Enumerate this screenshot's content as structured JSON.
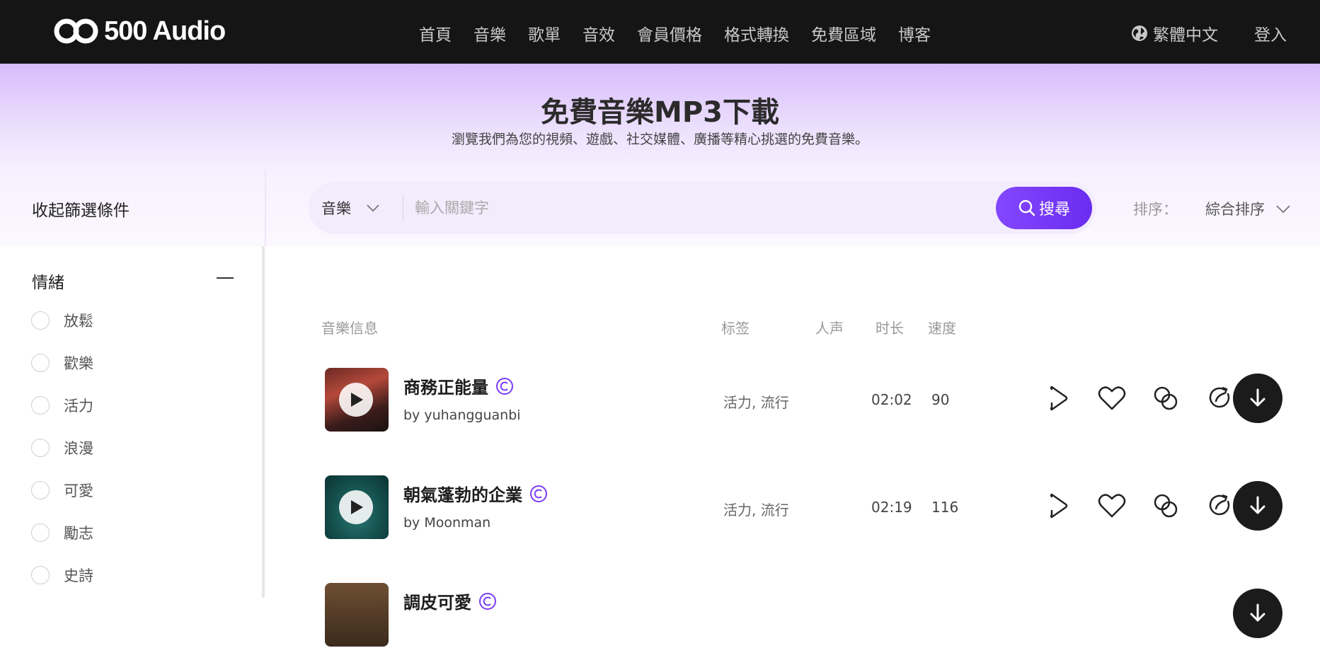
{
  "header": {
    "logo_text": "500 Audio",
    "nav": [
      "首頁",
      "音樂",
      "歌單",
      "音效",
      "會員價格",
      "格式轉換",
      "免費區域",
      "博客"
    ],
    "language": "繁體中文",
    "login": "登入"
  },
  "hero": {
    "title": "免費音樂MP3下載",
    "subtitle": "瀏覽我們為您的視頻、遊戲、社交媒體、廣播等精心挑選的免費音樂。"
  },
  "filter": {
    "collapse_label": "收起篩選條件",
    "category": "音樂",
    "search_placeholder": "輸入關鍵字",
    "search_button": "搜尋",
    "sort_label": "排序：",
    "sort_value": "綜合排序"
  },
  "sidebar": {
    "group_title": "情緒",
    "options": [
      "放鬆",
      "歡樂",
      "活力",
      "浪漫",
      "可愛",
      "勵志",
      "史詩"
    ]
  },
  "table": {
    "headers": {
      "info": "音樂信息",
      "tags": "标签",
      "vocal": "人声",
      "duration": "时长",
      "bpm": "速度"
    },
    "rows": [
      {
        "title": "商務正能量",
        "author": "by yuhangguanbi",
        "tags": "活力, 流行",
        "duration": "02:02",
        "bpm": "90",
        "thumb_colors": [
          "#7a2f25",
          "#3d1f1c"
        ]
      },
      {
        "title": "朝氣蓬勃的企業",
        "author": "by Moonman",
        "tags": "活力, 流行",
        "duration": "02:19",
        "bpm": "116",
        "thumb_colors": [
          "#1b5c59",
          "#0c3534"
        ]
      },
      {
        "title": "調皮可愛",
        "author": "",
        "tags": "",
        "duration": "",
        "bpm": "",
        "thumb_colors": [
          "#7a5c3a",
          "#3b2a1c"
        ]
      }
    ]
  },
  "colors": {
    "accent": "#7a3cf8",
    "header_bg": "#151515",
    "hero_top": "#d8bcfb"
  }
}
